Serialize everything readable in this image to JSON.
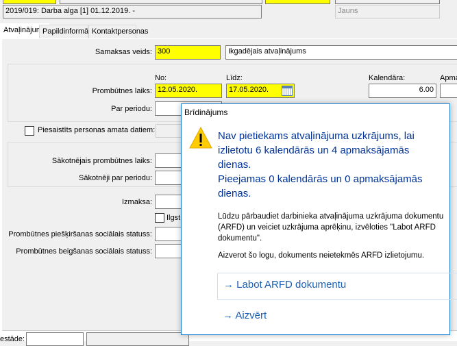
{
  "header": {
    "document": "2019/019: Darba alga [1] 01.12.2019. -",
    "status": "Jauns"
  },
  "tabs": [
    {
      "label": "Atvaļinājums"
    },
    {
      "label": "Papildinformācija"
    },
    {
      "label": "Kontaktpersonas"
    }
  ],
  "form": {
    "payment_type_label": "Samaksas veids:",
    "payment_type_code": "300",
    "payment_type_name": "Ikgadējais atvaļinājums",
    "from_label": "No:",
    "to_label": "Līdz:",
    "calendar_label": "Kalendāra:",
    "paid_label": "Apma",
    "absence_label": "Prombūtnes laiks:",
    "absence_from": "12.05.2020.",
    "absence_to": "17.05.2020.",
    "calendar_days": "6.00",
    "period_label": "Par periodu:",
    "linked_label": "Piesaistīts personas amata datiem:",
    "orig_absence_label": "Sākotnējais prombūtnes laiks:",
    "orig_period_label": "Sākotnēji par periodu:",
    "payout_label": "Izmaksa:",
    "long_label": "Ilgst",
    "start_status_label": "Prombūtnes piešķiršanas sociālais statuss:",
    "end_status_label": "Prombūtnes beigšanas sociālais statuss:",
    "bottom_label": "estāde:"
  },
  "dialog": {
    "title": "Brīdinājums",
    "main1": "Nav pietiekams atvaļinājuma uzkrājums, lai izlietotu 6 kalendārās un 4 apmaksājamās dienas.",
    "main2": "Pieejamas 0 kalendārās un 0 apmaksājamās dienas.",
    "body1": "Lūdzu pārbaudiet darbinieka atvaļinājuma uzkrājuma dokumentu (ARFD) un veiciet uzkrājuma aprēķinu, izvēloties \"Labot ARFD dokumentu\".",
    "body2": "Aizverot šo logu, dokuments neietekmēs ARFD izlietojumu.",
    "btn_edit": "Labot ARFD dokumentu",
    "btn_close": "Aizvērt"
  }
}
